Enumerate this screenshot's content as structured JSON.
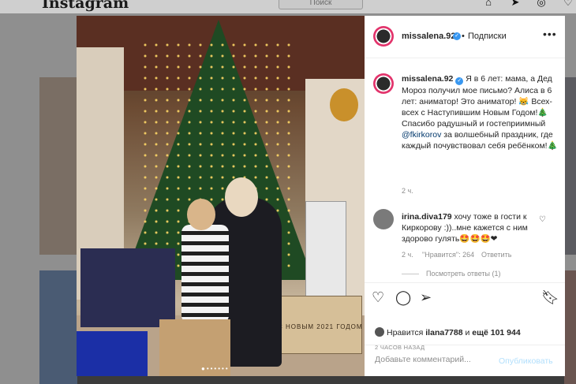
{
  "header": {
    "logo": "Instagram",
    "search_placeholder": "Поиск",
    "icons": [
      "home-icon",
      "direct-icon",
      "explore-icon",
      "activity-icon"
    ]
  },
  "post": {
    "username": "missalena.92",
    "follow_label": "Подписки",
    "more_label": "•••",
    "photo": {
      "crate_text": "С НОВЫМ 2021 ГОДОМ"
    },
    "caption": {
      "username": "missalena.92",
      "text_before_mention": "Я в 6 лет: мама, а Дед Мороз получил мое письмо? Алиса в 6 лет: аниматор! Это аниматор! 😹 Всех-всех с Наступившим Новым Годом!🎄 Спасибо радушный и гостеприимный ",
      "mention": "@fkirkorov",
      "text_after_mention": " за волшебный праздник, где каждый почувствовал себя ребёнком!🎄",
      "time": "2 ч."
    },
    "comment": {
      "username": "irina.diva179",
      "text": "хочу тоже в гости к Киркорову :))..мне кажется с ним здорово гулять🤩🤩🤩❤",
      "time": "2 ч.",
      "likes": "\"Нравится\": 264",
      "reply_label": "Ответить",
      "view_replies": "Посмотреть ответы (1)"
    },
    "likes": {
      "prefix": "Нравится",
      "user": "ilana7788",
      "joiner": "и",
      "others": "ещё 101 944"
    },
    "time_ago": "2 ЧАСОВ НАЗАД",
    "comment_placeholder": "Добавьте комментарий...",
    "publish_label": "Опубликовать"
  },
  "colors": {
    "verified": "#3897f0",
    "mention": "#00376b",
    "publish_disabled": "#b2dffc"
  }
}
